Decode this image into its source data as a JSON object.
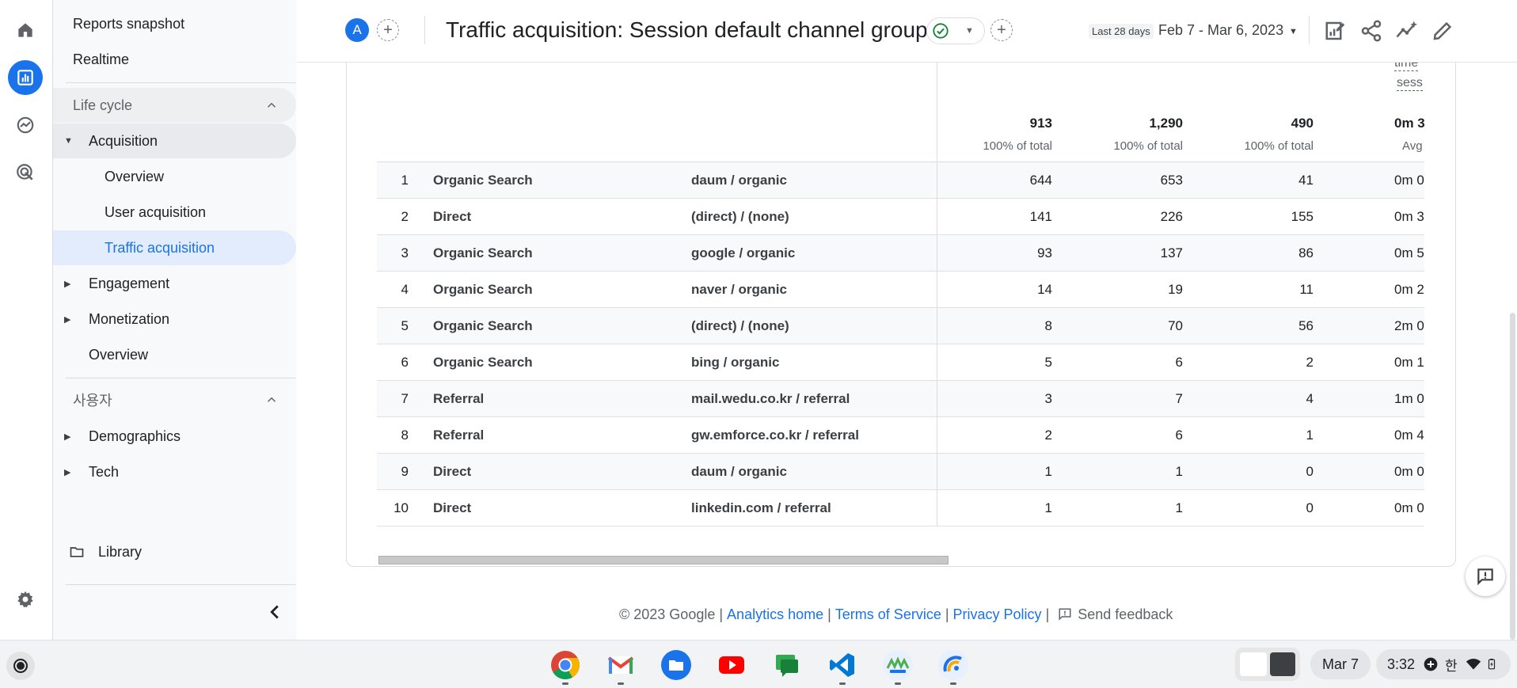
{
  "nav": {
    "reports_snapshot": "Reports snapshot",
    "realtime": "Realtime",
    "lifecycle_section": "Life cycle",
    "acquisition": "Acquisition",
    "overview": "Overview",
    "user_acquisition": "User acquisition",
    "traffic_acquisition": "Traffic acquisition",
    "engagement": "Engagement",
    "monetization": "Monetization",
    "overview2": "Overview",
    "user_section": "사용자",
    "demographics": "Demographics",
    "tech": "Tech",
    "library": "Library"
  },
  "header": {
    "avatar_letter": "A",
    "title": "Traffic acquisition: Session default channel group",
    "date_badge": "Last 28 days",
    "date_range": "Feb 7 - Mar 6, 2023"
  },
  "table": {
    "header_fragment_1": "time",
    "header_fragment_2": "sess",
    "totals": [
      {
        "value": "913",
        "sub": "100% of total"
      },
      {
        "value": "1,290",
        "sub": "100% of total"
      },
      {
        "value": "490",
        "sub": "100% of total"
      },
      {
        "value": "0m 3",
        "sub": "Avg"
      }
    ],
    "rows": [
      {
        "idx": "1",
        "channel": "Organic Search",
        "source": "daum / organic",
        "c1": "644",
        "c2": "653",
        "c3": "41",
        "c4": "0m 0"
      },
      {
        "idx": "2",
        "channel": "Direct",
        "source": "(direct) / (none)",
        "c1": "141",
        "c2": "226",
        "c3": "155",
        "c4": "0m 3"
      },
      {
        "idx": "3",
        "channel": "Organic Search",
        "source": "google / organic",
        "c1": "93",
        "c2": "137",
        "c3": "86",
        "c4": "0m 5"
      },
      {
        "idx": "4",
        "channel": "Organic Search",
        "source": "naver / organic",
        "c1": "14",
        "c2": "19",
        "c3": "11",
        "c4": "0m 2"
      },
      {
        "idx": "5",
        "channel": "Organic Search",
        "source": "(direct) / (none)",
        "c1": "8",
        "c2": "70",
        "c3": "56",
        "c4": "2m 0"
      },
      {
        "idx": "6",
        "channel": "Organic Search",
        "source": "bing / organic",
        "c1": "5",
        "c2": "6",
        "c3": "2",
        "c4": "0m 1"
      },
      {
        "idx": "7",
        "channel": "Referral",
        "source": "mail.wedu.co.kr / referral",
        "c1": "3",
        "c2": "7",
        "c3": "4",
        "c4": "1m 0"
      },
      {
        "idx": "8",
        "channel": "Referral",
        "source": "gw.emforce.co.kr / referral",
        "c1": "2",
        "c2": "6",
        "c3": "1",
        "c4": "0m 4"
      },
      {
        "idx": "9",
        "channel": "Direct",
        "source": "daum / organic",
        "c1": "1",
        "c2": "1",
        "c3": "0",
        "c4": "0m 0"
      },
      {
        "idx": "10",
        "channel": "Direct",
        "source": "linkedin.com / referral",
        "c1": "1",
        "c2": "1",
        "c3": "0",
        "c4": "0m 0"
      }
    ]
  },
  "footer": {
    "copyright": "© 2023 Google",
    "analytics_home": "Analytics home",
    "terms": "Terms of Service",
    "privacy": "Privacy Policy",
    "send_feedback": "Send feedback"
  },
  "taskbar": {
    "apps": [
      "chrome-icon",
      "gmail-icon",
      "files-icon",
      "youtube-icon",
      "chat-icon",
      "vscode-icon",
      "wemakeprice-icon",
      "analytics-app-icon"
    ],
    "date": "Mar 7",
    "time": "3:32",
    "ime": "한"
  },
  "colors": {
    "accent": "#1a73e8",
    "nav_bg": "#f8f9fa",
    "selected_bg": "#e2ecfc",
    "ok_green": "#188038"
  }
}
